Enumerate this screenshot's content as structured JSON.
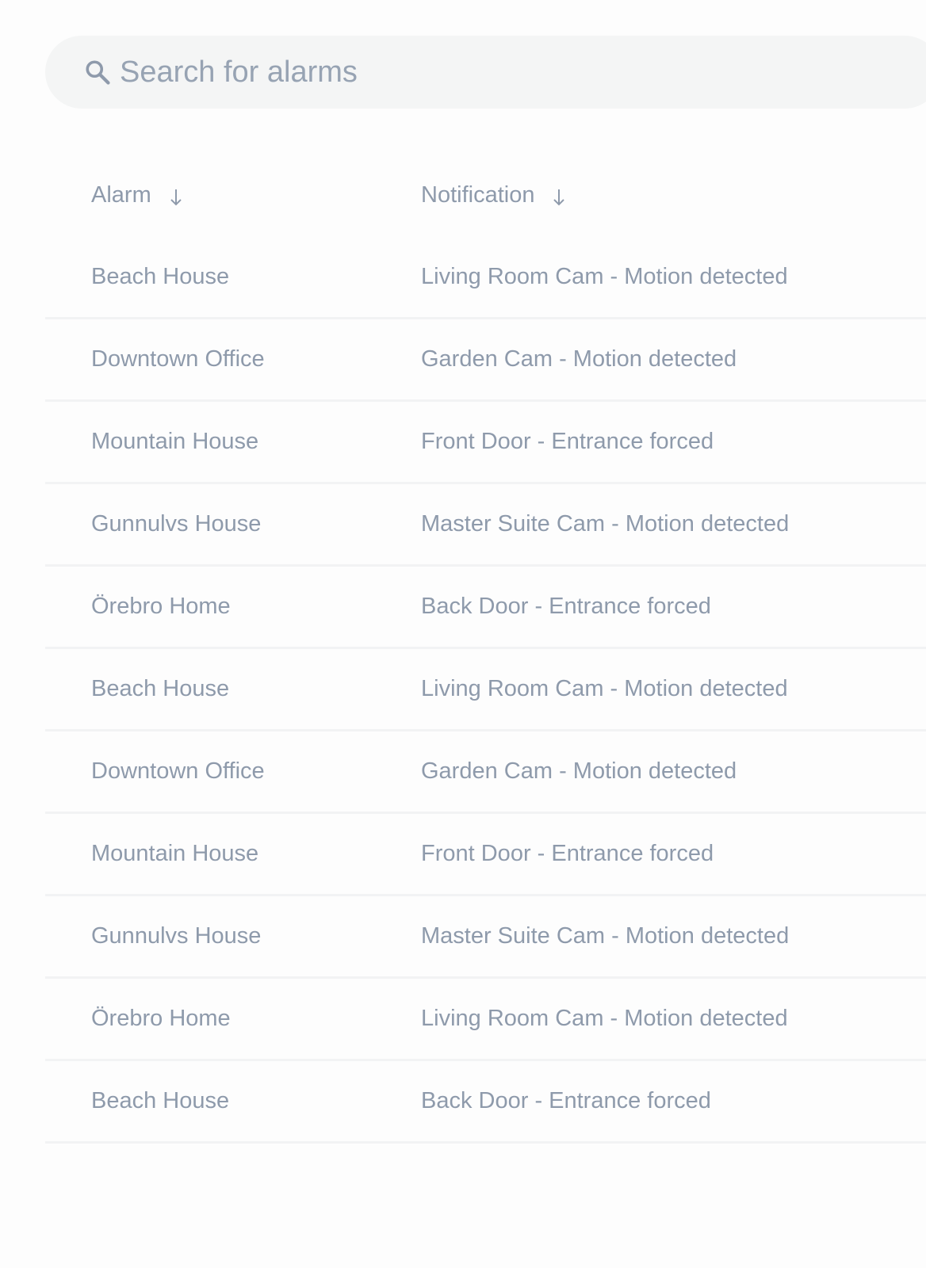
{
  "search": {
    "placeholder": "Search for alarms",
    "icon": "search-icon"
  },
  "table": {
    "columns": [
      {
        "label": "Alarm",
        "sort_icon": "arrow-down-icon"
      },
      {
        "label": "Notification",
        "sort_icon": "arrow-down-icon"
      }
    ],
    "rows": [
      {
        "alarm": "Beach House",
        "notification": "Living Room Cam - Motion detected"
      },
      {
        "alarm": "Downtown Office",
        "notification": "Garden Cam - Motion detected"
      },
      {
        "alarm": "Mountain House",
        "notification": "Front Door - Entrance forced"
      },
      {
        "alarm": "Gunnulvs House",
        "notification": "Master Suite Cam - Motion detected"
      },
      {
        "alarm": "Örebro Home",
        "notification": "Back Door -  Entrance forced"
      },
      {
        "alarm": "Beach House",
        "notification": "Living Room Cam - Motion detected"
      },
      {
        "alarm": "Downtown Office",
        "notification": "Garden Cam - Motion detected"
      },
      {
        "alarm": "Mountain House",
        "notification": "Front Door - Entrance forced"
      },
      {
        "alarm": "Gunnulvs House",
        "notification": "Master Suite Cam - Motion detected"
      },
      {
        "alarm": "Örebro Home",
        "notification": "Living Room Cam - Motion detected"
      },
      {
        "alarm": "Beach House",
        "notification": "Back Door -  Entrance forced"
      }
    ]
  },
  "colors": {
    "background": "#fdfdfd",
    "search_background": "#f4f5f5",
    "text": "#8e9aab",
    "divider": "#f2f3f4"
  }
}
